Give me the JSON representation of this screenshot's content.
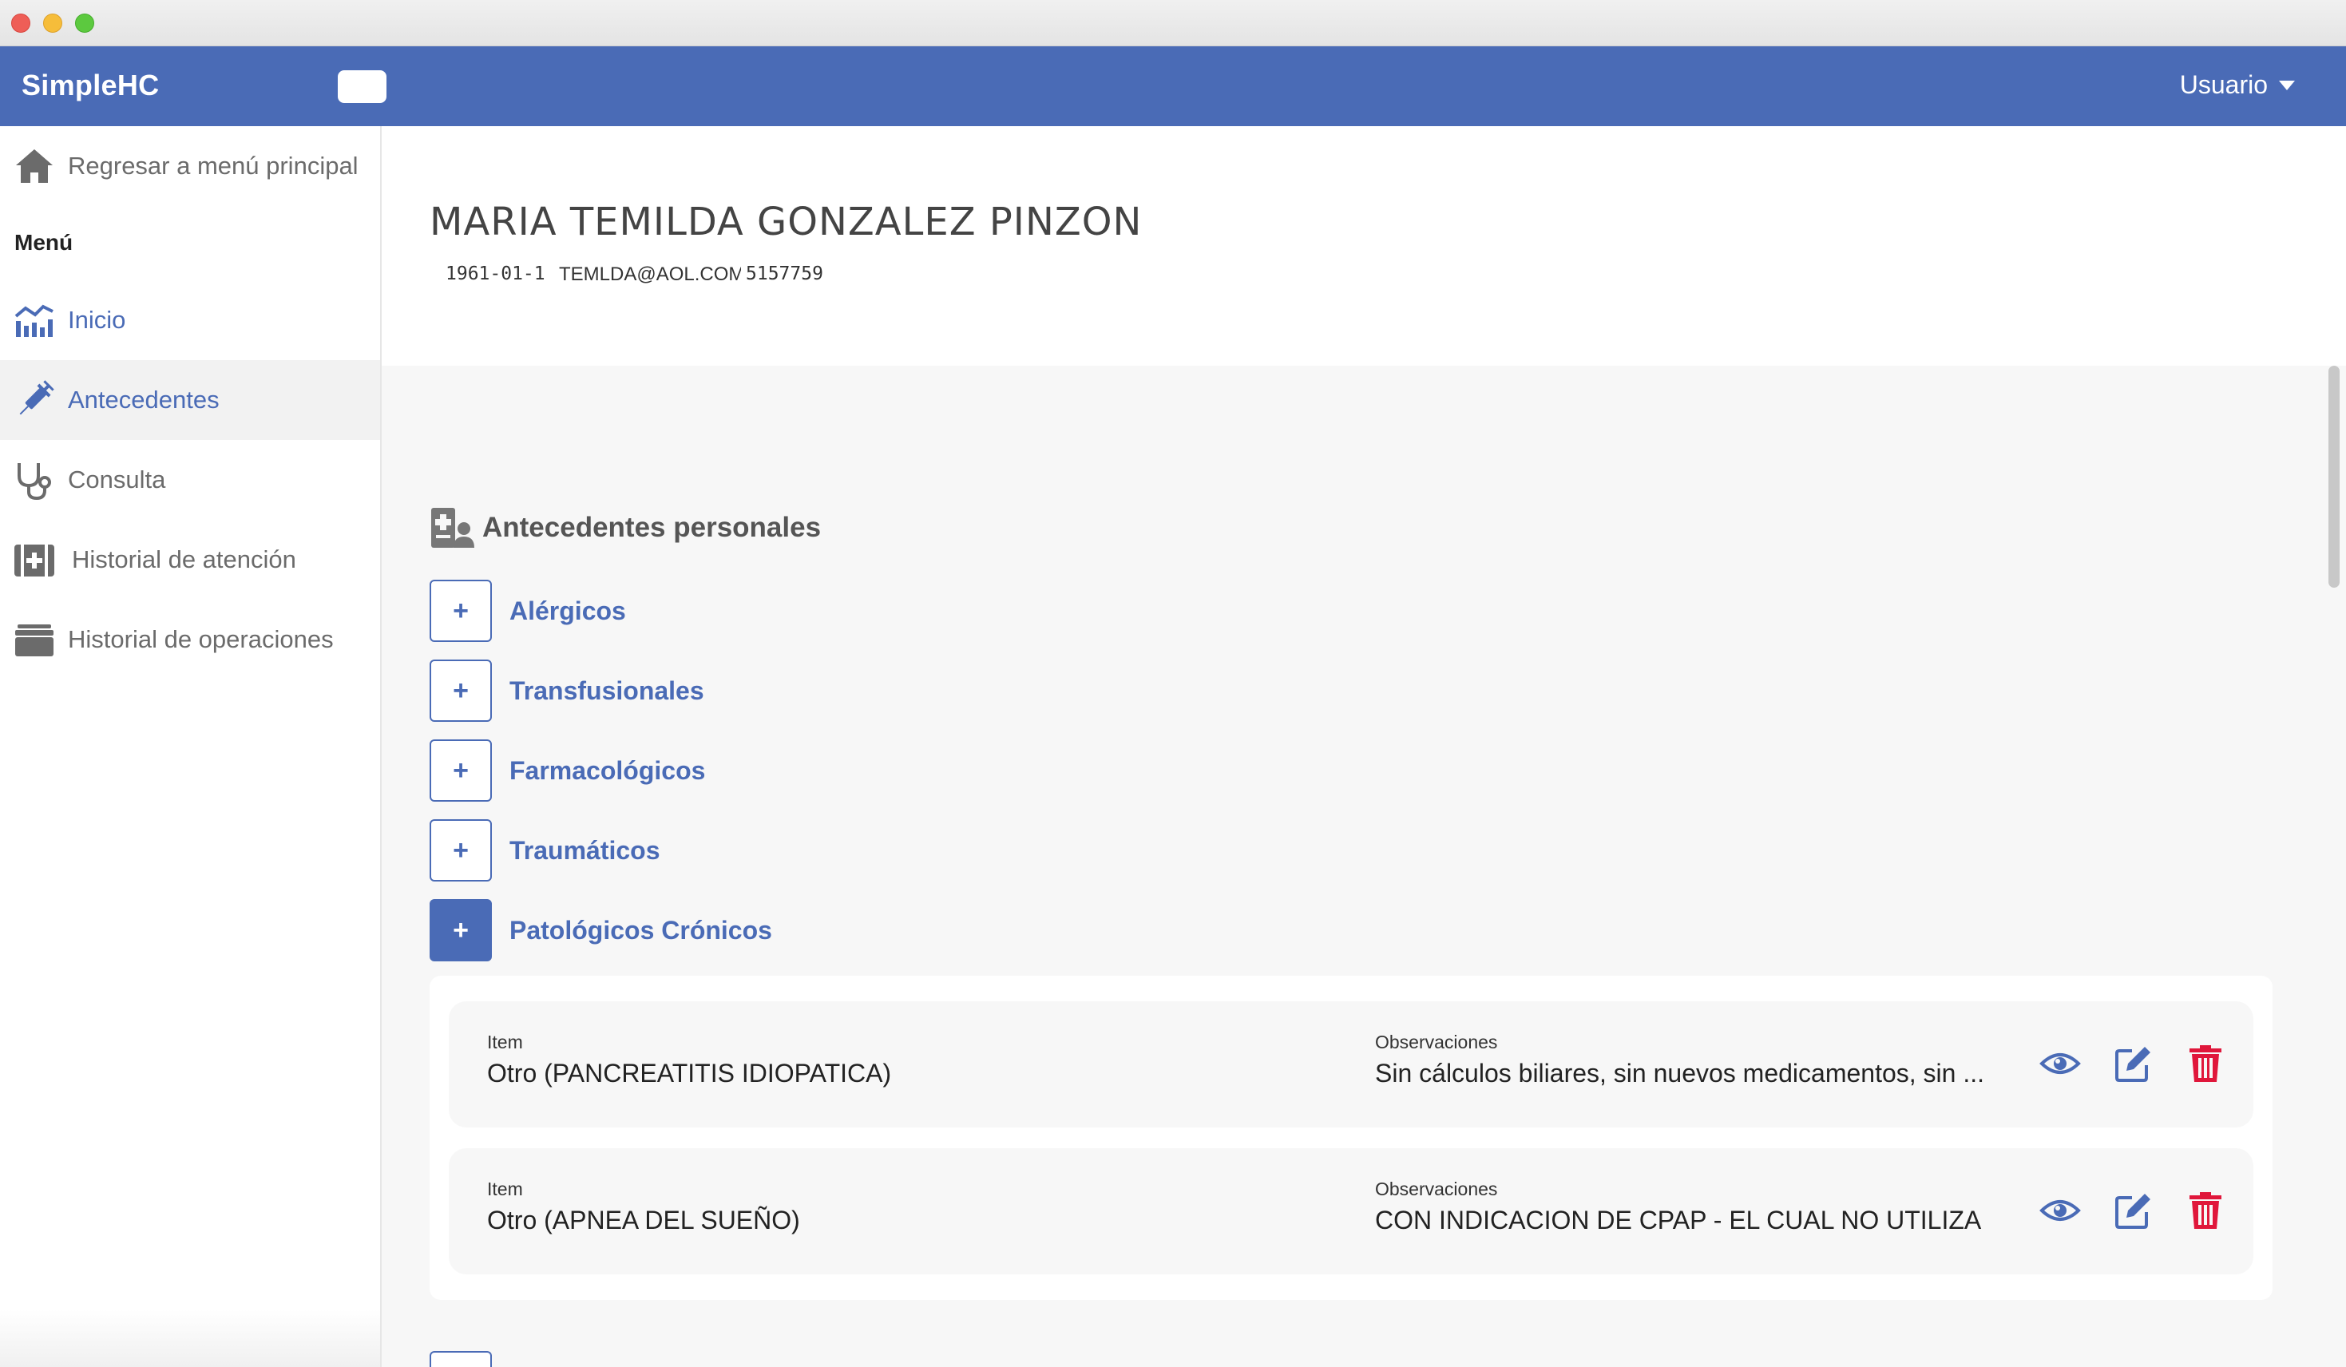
{
  "app": {
    "brand": "SimpleHC",
    "user_menu_label": "Usuario"
  },
  "colors": {
    "primary": "#4a6bb6",
    "danger": "#e0173b",
    "sidebar_active_bg": "#f2f2f2"
  },
  "sidebar": {
    "back_label": "Regresar a menú principal",
    "menu_heading": "Menú",
    "items": [
      {
        "label": "Inicio",
        "icon": "chart-line-icon"
      },
      {
        "label": "Antecedentes",
        "icon": "syringe-icon"
      },
      {
        "label": "Consulta",
        "icon": "stethoscope-icon"
      },
      {
        "label": "Historial de atención",
        "icon": "medical-kit-icon"
      },
      {
        "label": "Historial de operaciones",
        "icon": "archive-icon"
      }
    ]
  },
  "patient": {
    "name": "MARIA TEMILDA GONZALEZ PINZON",
    "dob": "1961-01-1",
    "email": "TEMLDA@AOL.COM",
    "phone": "5157759"
  },
  "section": {
    "title": "Antecedentes personales",
    "categories": [
      {
        "label": "Alérgicos",
        "button": "+"
      },
      {
        "label": "Transfusionales",
        "button": "+"
      },
      {
        "label": "Farmacológicos",
        "button": "+"
      },
      {
        "label": "Traumáticos",
        "button": "+"
      },
      {
        "label": "Patológicos Crónicos",
        "button": "+"
      }
    ]
  },
  "records": {
    "item_caption": "Item",
    "obs_caption": "Observaciones",
    "rows": [
      {
        "item": "Otro (PANCREATITIS IDIOPATICA)",
        "observaciones": "Sin cálculos biliares, sin nuevos medicamentos, sin ..."
      },
      {
        "item": "Otro (APNEA DEL SUEÑO)",
        "observaciones": "CON INDICACION DE CPAP - EL CUAL NO UTILIZA"
      }
    ]
  }
}
